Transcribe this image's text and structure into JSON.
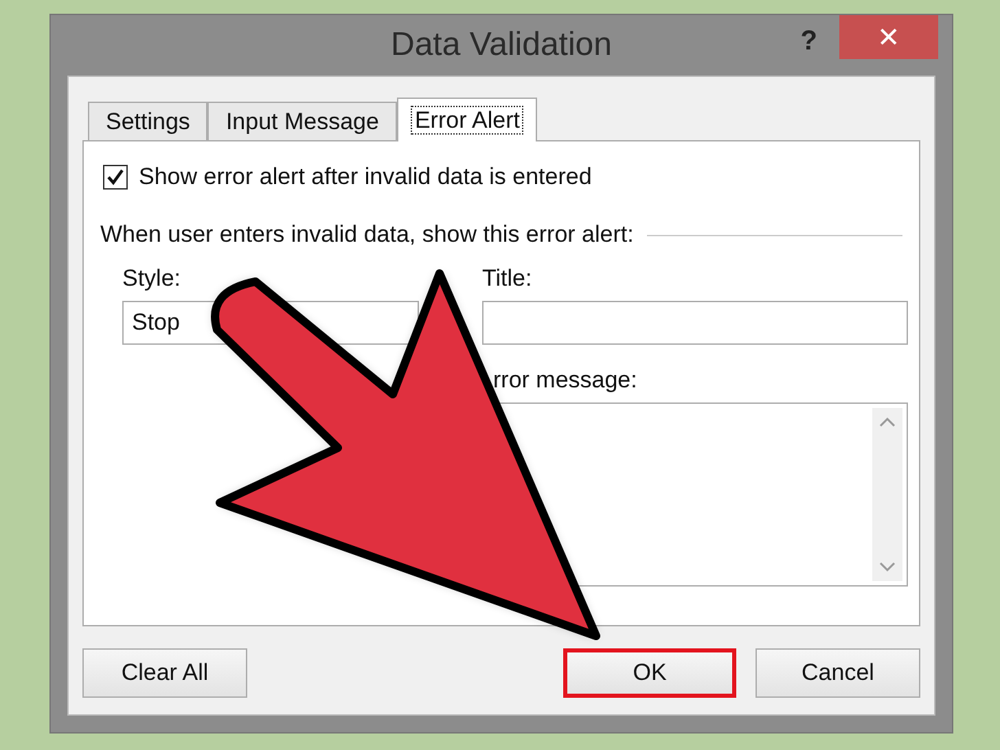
{
  "window": {
    "title": "Data Validation",
    "help": "?",
    "close": "✕"
  },
  "tabs": [
    {
      "label": "Settings",
      "selected": false
    },
    {
      "label": "Input Message",
      "selected": false
    },
    {
      "label": "Error Alert",
      "selected": true
    }
  ],
  "show_alert": {
    "label": "Show error alert after invalid data is entered",
    "checked": true
  },
  "group_label": "When user enters invalid data, show this error alert:",
  "style": {
    "label": "Style:",
    "value": "Stop"
  },
  "title_field": {
    "label": "Title:"
  },
  "message_field": {
    "label": "rror message:"
  },
  "buttons": [
    {
      "label": "Clear All",
      "highlighted": false
    },
    {
      "label": "OK",
      "highlighted": true
    },
    {
      "label": "Cancel",
      "highlighted": false
    }
  ]
}
